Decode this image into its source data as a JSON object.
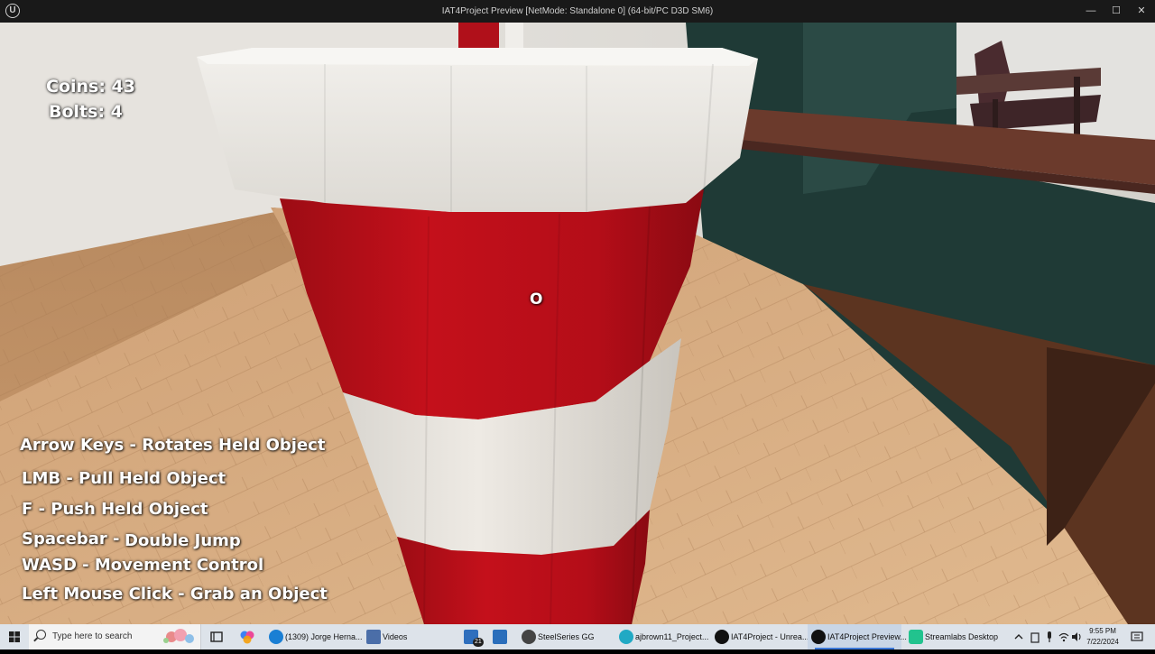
{
  "window": {
    "title": "IAT4Project Preview [NetMode: Standalone 0]  (64-bit/PC D3D SM6)",
    "logo": "U",
    "minimize": "—",
    "maximize": "☐",
    "close": "✕"
  },
  "hud": {
    "coins": "Coins: 43",
    "bolts": "Bolts: 4",
    "crosshair": "O",
    "controls": [
      "Arrow Keys - Rotates Held Object",
      "LMB - Pull Held Object",
      "F - Push Held Object",
      "Spacebar -",
      "Double Jump",
      "WASD - Movement Control",
      "Left Mouse Click - Grab an Object"
    ]
  },
  "taskbar": {
    "search_placeholder": "Type here to search",
    "apps": [
      {
        "label": "(1309) Jorge Herna...",
        "icon": "edge-icon",
        "color": "#1a7fd4"
      },
      {
        "label": "Videos",
        "icon": "folder-icon",
        "color": "#4b6ea8"
      },
      {
        "label": "",
        "icon": "mail-icon",
        "color": "#2f6fbd"
      },
      {
        "label": "",
        "icon": "store-icon",
        "color": "#2a6ebb"
      },
      {
        "label": "SteelSeries GG",
        "icon": "steelseries-icon",
        "color": "#444444"
      },
      {
        "label": "ajbrown11_Project...",
        "icon": "app-icon",
        "color": "#21a9c4"
      },
      {
        "label": "IAT4Project - Unrea...",
        "icon": "unreal-icon",
        "color": "#111111"
      },
      {
        "label": "IAT4Project Preview...",
        "icon": "unreal-icon",
        "color": "#111111"
      },
      {
        "label": "Streamlabs Desktop",
        "icon": "streamlabs-icon",
        "color": "#22c38e"
      }
    ],
    "mail_badge": "21",
    "time": "9:55 PM",
    "date": "7/22/2024"
  }
}
